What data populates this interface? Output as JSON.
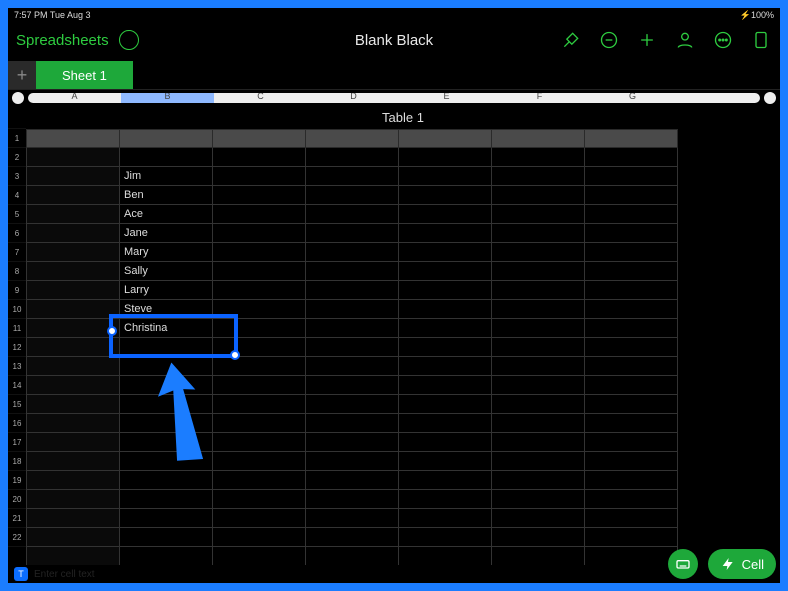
{
  "status": {
    "left": "7:57 PM   Tue Aug 3",
    "right": "⚡100%"
  },
  "toolbar": {
    "app_name": "Spreadsheets",
    "doc_title": "Blank Black"
  },
  "sheets": {
    "add_glyph": "+",
    "tab1": "Sheet 1"
  },
  "column_letters": [
    "A",
    "B",
    "C",
    "D",
    "E",
    "F",
    "G"
  ],
  "ruler_selected_index": 1,
  "table": {
    "title": "Table 1",
    "num_cols": 7,
    "num_rows": 22,
    "columnB": [
      "",
      "Jim",
      "Ben",
      "Ace",
      "Jane",
      "Mary",
      "Sally",
      "Larry",
      "Steve",
      "Christina",
      "",
      "",
      "",
      "",
      "",
      "",
      "",
      "",
      "",
      "",
      "",
      ""
    ]
  },
  "selection": {
    "col": "B",
    "row": 11
  },
  "bottom": {
    "formula_hint": "Enter cell text"
  },
  "fab": {
    "cell_label": "Cell"
  }
}
